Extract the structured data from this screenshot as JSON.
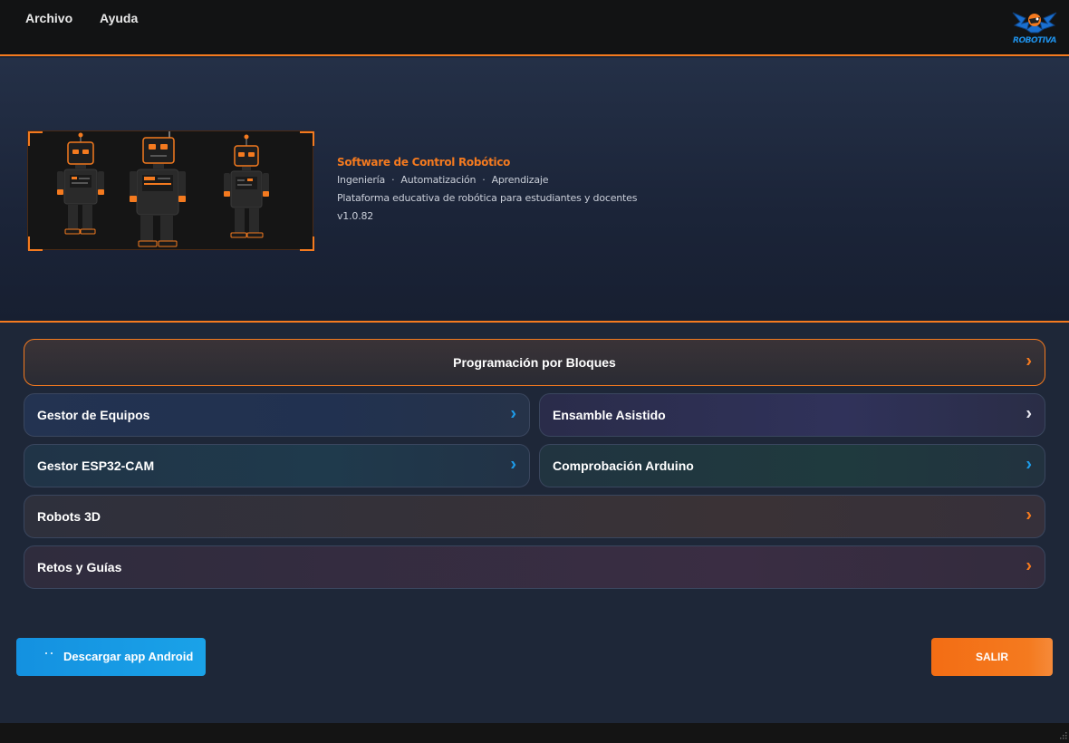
{
  "menubar": {
    "items": [
      "Archivo",
      "Ayuda"
    ],
    "logo_text": "ROBOTIVA"
  },
  "hero": {
    "title": "Software de Control Robótico",
    "tags": [
      "Ingeniería",
      "Automatización",
      "Aprendizaje"
    ],
    "description": "Plataforma educativa de robótica para estudiantes y docentes",
    "version": "v1.0.82"
  },
  "modules": {
    "main": "Programación por Bloques",
    "equipos": "Gestor de Equipos",
    "ensamble": "Ensamble Asistido",
    "esp32": "Gestor ESP32-CAM",
    "arduino": "Comprobación Arduino",
    "robots3d": "Robots 3D",
    "retos": "Retos y Guías",
    "chevron": "›"
  },
  "footer": {
    "android_label": "Descargar app Android",
    "exit_label": "SALIR"
  },
  "colors": {
    "accent": "#f47a1f",
    "blue_chevron": "#1e9be8",
    "android": "#1491e0"
  },
  "icons": [
    "robivo-logo-icon",
    "robot-illustration",
    "android-icon",
    "chevron-right-icon",
    "resize-grip-icon"
  ]
}
